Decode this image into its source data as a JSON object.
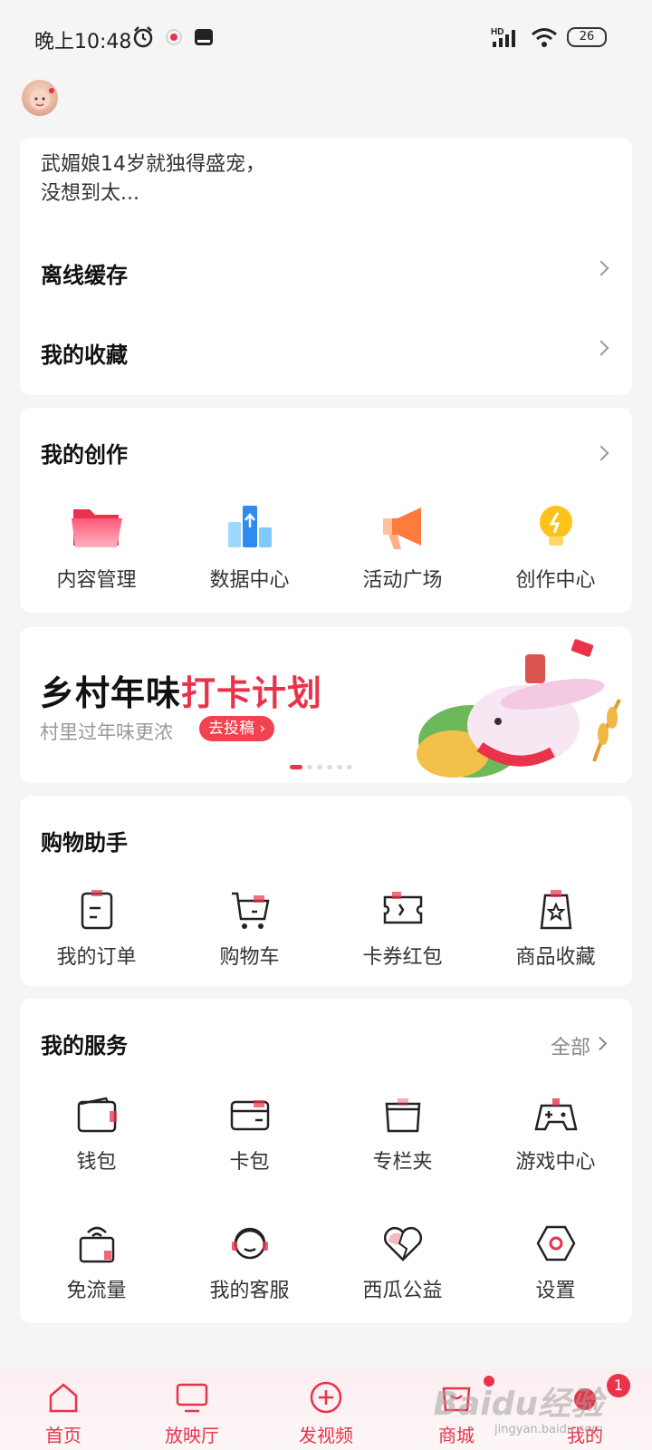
{
  "status_bar": {
    "time": "晚上10:48",
    "network": "HD",
    "battery": "26"
  },
  "recent": {
    "video_title": "武媚娘14岁就独得盛宠，没想到太..."
  },
  "menu": {
    "offline_cache": "离线缓存",
    "favorites": "我的收藏"
  },
  "creation": {
    "title": "我的创作",
    "items": [
      {
        "label": "内容管理",
        "icon": "folder-icon"
      },
      {
        "label": "数据中心",
        "icon": "data-chart-icon"
      },
      {
        "label": "活动广场",
        "icon": "megaphone-icon"
      },
      {
        "label": "创作中心",
        "icon": "lightbulb-icon"
      }
    ]
  },
  "banner": {
    "title_black": "乡村年味",
    "title_red": "打卡计划",
    "subtitle": "村里过年味更浓",
    "button": "去投稿"
  },
  "shopping": {
    "title": "购物助手",
    "items": [
      {
        "label": "我的订单",
        "icon": "order-icon"
      },
      {
        "label": "购物车",
        "icon": "cart-icon"
      },
      {
        "label": "卡券红包",
        "icon": "coupon-icon"
      },
      {
        "label": "商品收藏",
        "icon": "bag-star-icon"
      }
    ]
  },
  "services": {
    "title": "我的服务",
    "all_label": "全部",
    "items": [
      {
        "label": "钱包",
        "icon": "wallet-icon"
      },
      {
        "label": "卡包",
        "icon": "card-icon"
      },
      {
        "label": "专栏夹",
        "icon": "folder-column-icon"
      },
      {
        "label": "游戏中心",
        "icon": "gamepad-icon"
      },
      {
        "label": "免流量",
        "icon": "free-data-icon"
      },
      {
        "label": "我的客服",
        "icon": "headset-icon"
      },
      {
        "label": "西瓜公益",
        "icon": "heart-icon"
      },
      {
        "label": "设置",
        "icon": "settings-hex-icon"
      }
    ]
  },
  "tabbar": {
    "items": [
      {
        "label": "首页",
        "icon": "home-icon"
      },
      {
        "label": "放映厅",
        "icon": "tv-icon"
      },
      {
        "label": "发视频",
        "icon": "plus-circle-icon"
      },
      {
        "label": "商城",
        "icon": "shopping-bag-icon"
      },
      {
        "label": "我的",
        "icon": "profile-icon"
      }
    ],
    "mine_badge": "1"
  },
  "watermark": {
    "text": "Baidu经验",
    "url": "jingyan.baidu.com"
  },
  "colors": {
    "accent": "#e8334a",
    "background": "#f5f5f6",
    "card": "#ffffff"
  }
}
